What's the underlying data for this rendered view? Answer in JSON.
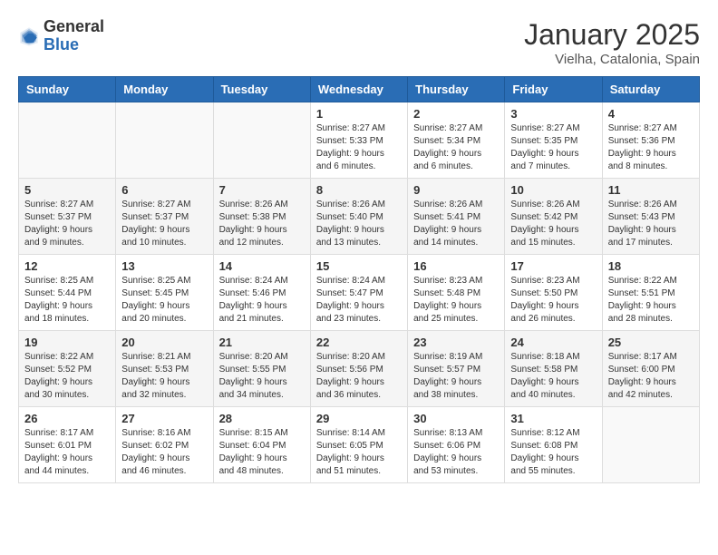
{
  "header": {
    "logo_general": "General",
    "logo_blue": "Blue",
    "month": "January 2025",
    "location": "Vielha, Catalonia, Spain"
  },
  "weekdays": [
    "Sunday",
    "Monday",
    "Tuesday",
    "Wednesday",
    "Thursday",
    "Friday",
    "Saturday"
  ],
  "weeks": [
    [
      {
        "day": "",
        "sunrise": "",
        "sunset": "",
        "daylight": ""
      },
      {
        "day": "",
        "sunrise": "",
        "sunset": "",
        "daylight": ""
      },
      {
        "day": "",
        "sunrise": "",
        "sunset": "",
        "daylight": ""
      },
      {
        "day": "1",
        "sunrise": "Sunrise: 8:27 AM",
        "sunset": "Sunset: 5:33 PM",
        "daylight": "Daylight: 9 hours and 6 minutes."
      },
      {
        "day": "2",
        "sunrise": "Sunrise: 8:27 AM",
        "sunset": "Sunset: 5:34 PM",
        "daylight": "Daylight: 9 hours and 6 minutes."
      },
      {
        "day": "3",
        "sunrise": "Sunrise: 8:27 AM",
        "sunset": "Sunset: 5:35 PM",
        "daylight": "Daylight: 9 hours and 7 minutes."
      },
      {
        "day": "4",
        "sunrise": "Sunrise: 8:27 AM",
        "sunset": "Sunset: 5:36 PM",
        "daylight": "Daylight: 9 hours and 8 minutes."
      }
    ],
    [
      {
        "day": "5",
        "sunrise": "Sunrise: 8:27 AM",
        "sunset": "Sunset: 5:37 PM",
        "daylight": "Daylight: 9 hours and 9 minutes."
      },
      {
        "day": "6",
        "sunrise": "Sunrise: 8:27 AM",
        "sunset": "Sunset: 5:37 PM",
        "daylight": "Daylight: 9 hours and 10 minutes."
      },
      {
        "day": "7",
        "sunrise": "Sunrise: 8:26 AM",
        "sunset": "Sunset: 5:38 PM",
        "daylight": "Daylight: 9 hours and 12 minutes."
      },
      {
        "day": "8",
        "sunrise": "Sunrise: 8:26 AM",
        "sunset": "Sunset: 5:40 PM",
        "daylight": "Daylight: 9 hours and 13 minutes."
      },
      {
        "day": "9",
        "sunrise": "Sunrise: 8:26 AM",
        "sunset": "Sunset: 5:41 PM",
        "daylight": "Daylight: 9 hours and 14 minutes."
      },
      {
        "day": "10",
        "sunrise": "Sunrise: 8:26 AM",
        "sunset": "Sunset: 5:42 PM",
        "daylight": "Daylight: 9 hours and 15 minutes."
      },
      {
        "day": "11",
        "sunrise": "Sunrise: 8:26 AM",
        "sunset": "Sunset: 5:43 PM",
        "daylight": "Daylight: 9 hours and 17 minutes."
      }
    ],
    [
      {
        "day": "12",
        "sunrise": "Sunrise: 8:25 AM",
        "sunset": "Sunset: 5:44 PM",
        "daylight": "Daylight: 9 hours and 18 minutes."
      },
      {
        "day": "13",
        "sunrise": "Sunrise: 8:25 AM",
        "sunset": "Sunset: 5:45 PM",
        "daylight": "Daylight: 9 hours and 20 minutes."
      },
      {
        "day": "14",
        "sunrise": "Sunrise: 8:24 AM",
        "sunset": "Sunset: 5:46 PM",
        "daylight": "Daylight: 9 hours and 21 minutes."
      },
      {
        "day": "15",
        "sunrise": "Sunrise: 8:24 AM",
        "sunset": "Sunset: 5:47 PM",
        "daylight": "Daylight: 9 hours and 23 minutes."
      },
      {
        "day": "16",
        "sunrise": "Sunrise: 8:23 AM",
        "sunset": "Sunset: 5:48 PM",
        "daylight": "Daylight: 9 hours and 25 minutes."
      },
      {
        "day": "17",
        "sunrise": "Sunrise: 8:23 AM",
        "sunset": "Sunset: 5:50 PM",
        "daylight": "Daylight: 9 hours and 26 minutes."
      },
      {
        "day": "18",
        "sunrise": "Sunrise: 8:22 AM",
        "sunset": "Sunset: 5:51 PM",
        "daylight": "Daylight: 9 hours and 28 minutes."
      }
    ],
    [
      {
        "day": "19",
        "sunrise": "Sunrise: 8:22 AM",
        "sunset": "Sunset: 5:52 PM",
        "daylight": "Daylight: 9 hours and 30 minutes."
      },
      {
        "day": "20",
        "sunrise": "Sunrise: 8:21 AM",
        "sunset": "Sunset: 5:53 PM",
        "daylight": "Daylight: 9 hours and 32 minutes."
      },
      {
        "day": "21",
        "sunrise": "Sunrise: 8:20 AM",
        "sunset": "Sunset: 5:55 PM",
        "daylight": "Daylight: 9 hours and 34 minutes."
      },
      {
        "day": "22",
        "sunrise": "Sunrise: 8:20 AM",
        "sunset": "Sunset: 5:56 PM",
        "daylight": "Daylight: 9 hours and 36 minutes."
      },
      {
        "day": "23",
        "sunrise": "Sunrise: 8:19 AM",
        "sunset": "Sunset: 5:57 PM",
        "daylight": "Daylight: 9 hours and 38 minutes."
      },
      {
        "day": "24",
        "sunrise": "Sunrise: 8:18 AM",
        "sunset": "Sunset: 5:58 PM",
        "daylight": "Daylight: 9 hours and 40 minutes."
      },
      {
        "day": "25",
        "sunrise": "Sunrise: 8:17 AM",
        "sunset": "Sunset: 6:00 PM",
        "daylight": "Daylight: 9 hours and 42 minutes."
      }
    ],
    [
      {
        "day": "26",
        "sunrise": "Sunrise: 8:17 AM",
        "sunset": "Sunset: 6:01 PM",
        "daylight": "Daylight: 9 hours and 44 minutes."
      },
      {
        "day": "27",
        "sunrise": "Sunrise: 8:16 AM",
        "sunset": "Sunset: 6:02 PM",
        "daylight": "Daylight: 9 hours and 46 minutes."
      },
      {
        "day": "28",
        "sunrise": "Sunrise: 8:15 AM",
        "sunset": "Sunset: 6:04 PM",
        "daylight": "Daylight: 9 hours and 48 minutes."
      },
      {
        "day": "29",
        "sunrise": "Sunrise: 8:14 AM",
        "sunset": "Sunset: 6:05 PM",
        "daylight": "Daylight: 9 hours and 51 minutes."
      },
      {
        "day": "30",
        "sunrise": "Sunrise: 8:13 AM",
        "sunset": "Sunset: 6:06 PM",
        "daylight": "Daylight: 9 hours and 53 minutes."
      },
      {
        "day": "31",
        "sunrise": "Sunrise: 8:12 AM",
        "sunset": "Sunset: 6:08 PM",
        "daylight": "Daylight: 9 hours and 55 minutes."
      },
      {
        "day": "",
        "sunrise": "",
        "sunset": "",
        "daylight": ""
      }
    ]
  ]
}
